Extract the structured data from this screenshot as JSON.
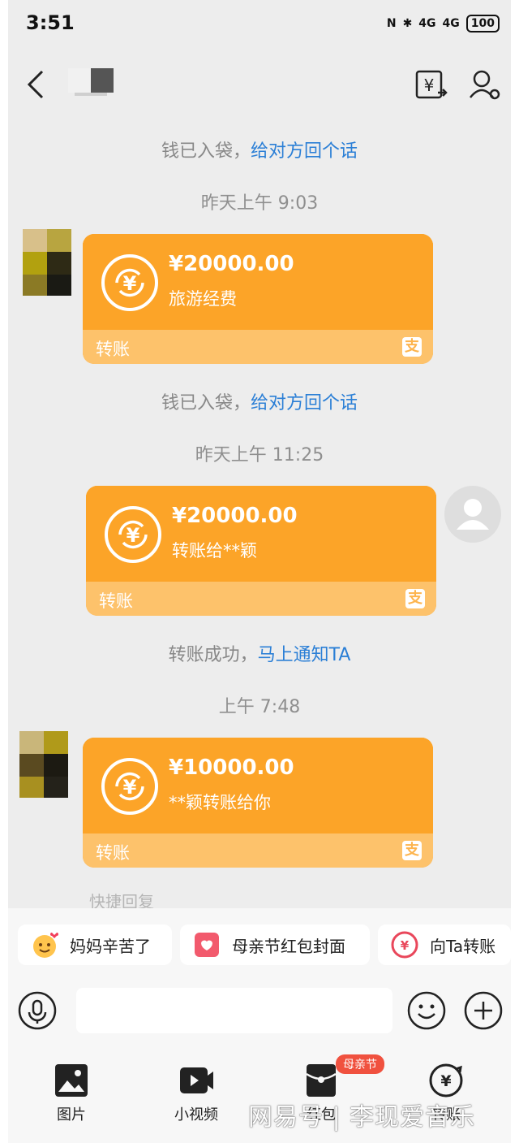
{
  "status": {
    "time": "3:51",
    "network1": "4G",
    "network2": "4G",
    "battery": "100"
  },
  "system_messages": [
    {
      "text": "钱已入袋，",
      "link": "给对方回个话"
    },
    {
      "text": "钱已入袋，",
      "link": "给对方回个话"
    },
    {
      "text": "转账成功，",
      "link": "马上通知TA"
    }
  ],
  "timestamps": [
    "昨天上午 9:03",
    "昨天上午 11:25",
    "上午 7:48"
  ],
  "transfers": [
    {
      "amount": "¥20000.00",
      "memo": "旅游经费",
      "kind": "转账",
      "alipay": "支"
    },
    {
      "amount": "¥20000.00",
      "memo": "转账给**颖",
      "kind": "转账",
      "alipay": "支"
    },
    {
      "amount": "¥10000.00",
      "memo": "**颖转账给你",
      "kind": "转账",
      "alipay": "支"
    }
  ],
  "quick_reply_label": "快捷回复",
  "quick_replies": [
    {
      "label": "妈妈辛苦了",
      "icon": "smiley-hearts-icon"
    },
    {
      "label": "母亲节红包封面",
      "icon": "red-envelope-cover-icon"
    },
    {
      "label": "向Ta转账",
      "icon": "transfer-coin-icon"
    }
  ],
  "toolbar": [
    {
      "label": "图片",
      "icon": "image-icon"
    },
    {
      "label": "小视频",
      "icon": "video-icon"
    },
    {
      "label": "红包",
      "icon": "red-envelope-icon"
    },
    {
      "label": "转账",
      "icon": "transfer-icon"
    }
  ],
  "badge": "母亲节",
  "watermark": "网易号 | 李现爱音乐",
  "colors": {
    "card": "#fca428",
    "card_footer": "#fdc26b",
    "link": "#2b7fd6"
  }
}
